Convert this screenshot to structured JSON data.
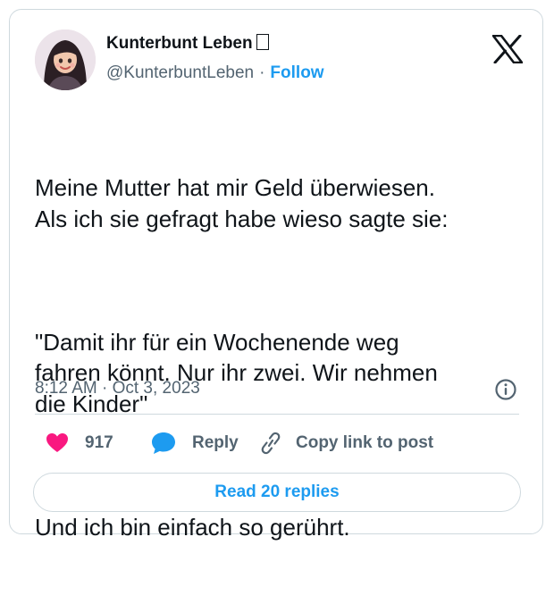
{
  "author": {
    "name": "Kunterbunt Leben",
    "handle": "@KunterbuntLeben",
    "separator": "·",
    "follow_label": "Follow"
  },
  "tweet": {
    "paragraphs": [
      "Meine Mutter hat mir Geld überwiesen.\nAls ich sie gefragt habe wieso sagte sie:",
      "\"Damit ihr für ein Wochenende weg\nfahren könnt. Nur ihr zwei. Wir nehmen\ndie Kinder\"",
      "Und ich bin einfach so gerührt."
    ],
    "timestamp": "8:12 AM · Oct 3, 2023"
  },
  "actions": {
    "like_count": "917",
    "reply_label": "Reply",
    "copy_link_label": "Copy link to post",
    "read_replies_label": "Read 20 replies"
  },
  "icons": {
    "like": "heart-icon",
    "reply": "speech-bubble-icon",
    "copy": "link-icon",
    "info": "info-icon",
    "brand": "x-logo-icon"
  },
  "colors": {
    "accent": "#1d9bf0",
    "like": "#f91880",
    "text": "#0f1419",
    "muted": "#536471",
    "border": "#cfd9de"
  }
}
